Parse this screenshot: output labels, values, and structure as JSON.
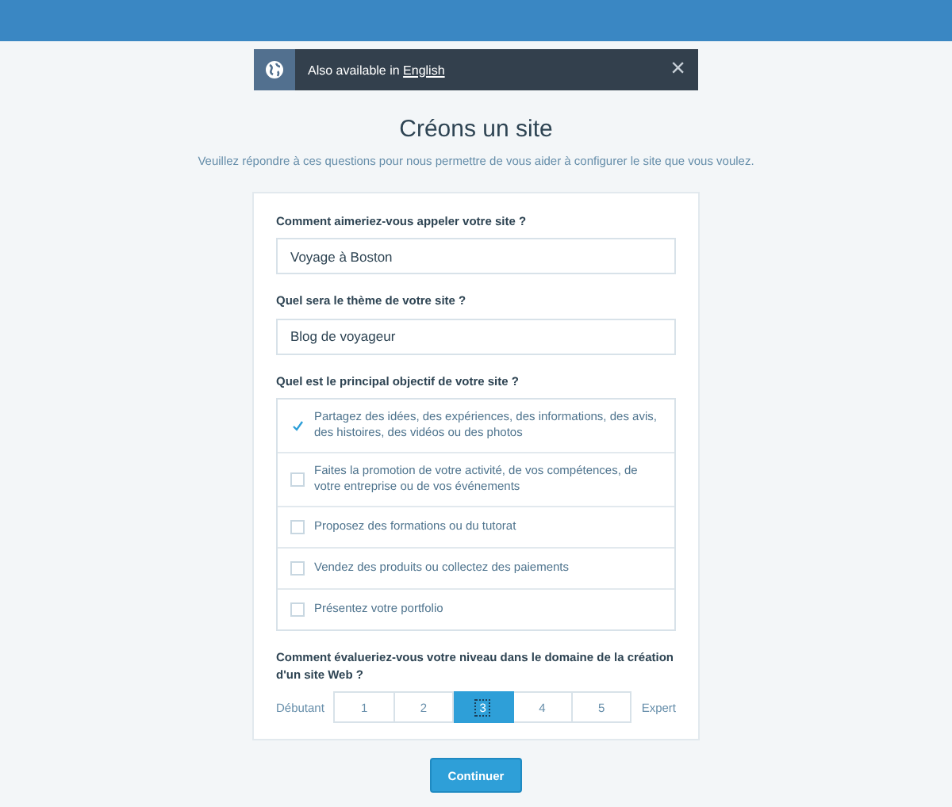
{
  "banner": {
    "text": "Also available in ",
    "link": "English",
    "close": "×"
  },
  "title": "Créons un site",
  "subtitle": "Veuillez répondre à ces questions pour nous permettre de vous aider à configurer le site que vous voulez.",
  "fields": [
    {
      "label": "Comment aimeriez-vous appeler votre site ?",
      "value": "Voyage à Boston"
    },
    {
      "label": "Quel sera le thème de votre site ?",
      "value": "Blog de voyageur"
    }
  ],
  "goal": {
    "label": "Quel est le principal objectif de votre site ?",
    "options": [
      {
        "text": "Partagez des idées, des expériences, des informations, des avis, des histoires, des vidéos ou des photos",
        "checked": true
      },
      {
        "text": "Faites la promotion de votre activité, de vos compétences, de votre entreprise ou de vos événements",
        "checked": false
      },
      {
        "text": "Proposez des formations ou du tutorat",
        "checked": false
      },
      {
        "text": "Vendez des produits ou collectez des paiements",
        "checked": false
      },
      {
        "text": "Présentez votre portfolio",
        "checked": false
      }
    ]
  },
  "level": {
    "label": "Comment évalueriez-vous votre niveau dans le domaine de la création d'un site Web ?",
    "min_label": "Débutant",
    "max_label": "Expert",
    "options": [
      {
        "label": "1",
        "selected": false
      },
      {
        "label": "2",
        "selected": false
      },
      {
        "label": "3",
        "selected": true
      },
      {
        "label": "4",
        "selected": false
      },
      {
        "label": "5",
        "selected": false
      }
    ]
  },
  "button": "Continuer"
}
